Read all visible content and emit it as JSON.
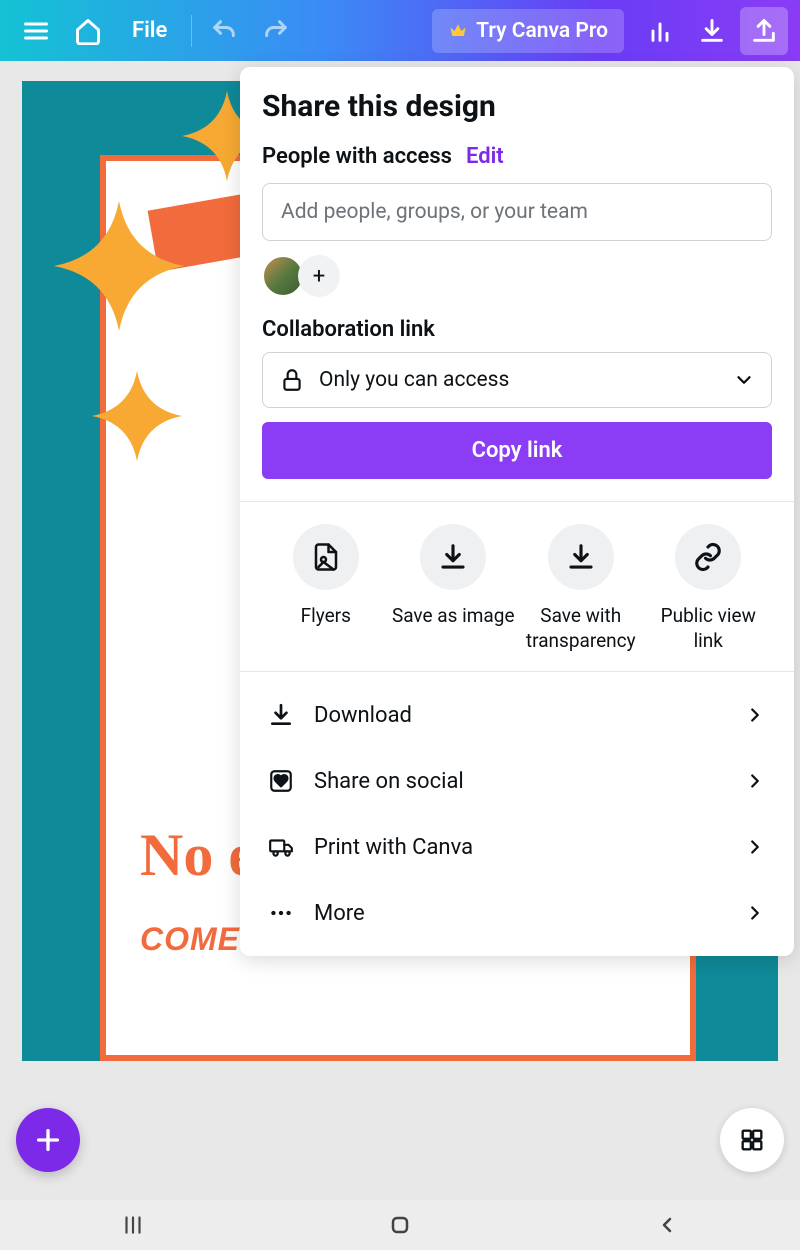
{
  "topbar": {
    "file": "File",
    "try_pro": "Try Canva Pro"
  },
  "share": {
    "title": "Share this design",
    "access_label": "People with access",
    "edit": "Edit",
    "input_placeholder": "Add people, groups, or your team",
    "collab_label": "Collaboration link",
    "access_value": "Only you can access",
    "copy": "Copy link",
    "actions": [
      {
        "label": "Flyers"
      },
      {
        "label": "Save as image"
      },
      {
        "label": "Save with transparency"
      },
      {
        "label": "Public view link"
      }
    ],
    "menu": [
      {
        "label": "Download"
      },
      {
        "label": "Share on social"
      },
      {
        "label": "Print with Canva"
      },
      {
        "label": "More"
      }
    ]
  },
  "poster": {
    "line3": "No e",
    "line4": "COME AND APEAR TO THE MANAGER"
  }
}
